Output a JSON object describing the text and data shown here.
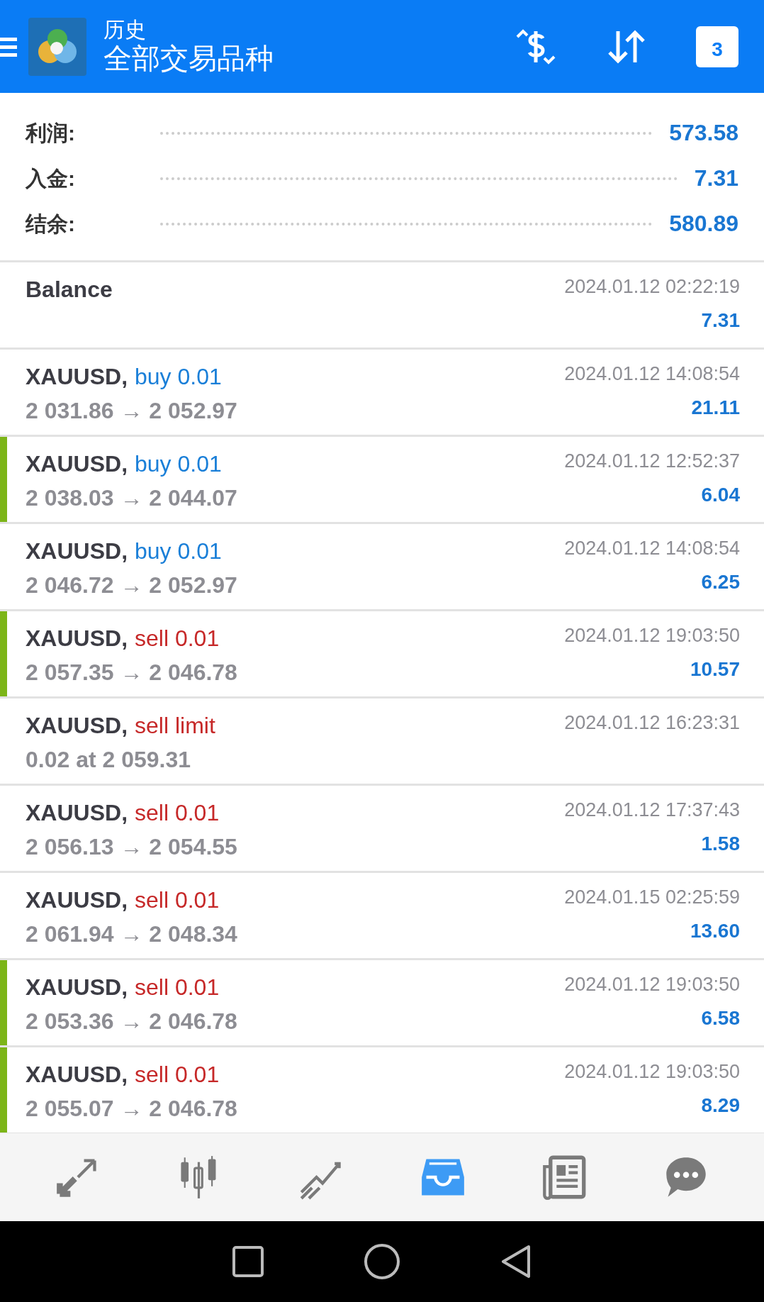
{
  "header": {
    "title": "历史",
    "subtitle": "全部交易品种",
    "calendar_day": "3"
  },
  "summary": [
    {
      "label": "利润:",
      "value": "573.58"
    },
    {
      "label": "入金:",
      "value": "7.31"
    },
    {
      "label": "结余:",
      "value": "580.89"
    }
  ],
  "deals": [
    {
      "kind": "balance",
      "symbol": "Balance",
      "time": "2024.01.12 02:22:19",
      "profit": "7.31",
      "marked": false
    },
    {
      "kind": "trade",
      "symbol": "XAUUSD,",
      "color": "#1a7fd8",
      "action": "buy 0.01",
      "prices": "2 031.86 → 2 052.97",
      "time": "2024.01.12 14:08:54",
      "profit": "21.11",
      "marked": false
    },
    {
      "kind": "trade",
      "symbol": "XAUUSD,",
      "color": "#1a7fd8",
      "action": "buy 0.01",
      "prices": "2 038.03 → 2 044.07",
      "time": "2024.01.12 12:52:37",
      "profit": "6.04",
      "marked": true
    },
    {
      "kind": "trade",
      "symbol": "XAUUSD,",
      "color": "#1a7fd8",
      "action": "buy 0.01",
      "prices": "2 046.72 → 2 052.97",
      "time": "2024.01.12 14:08:54",
      "profit": "6.25",
      "marked": false
    },
    {
      "kind": "trade",
      "symbol": "XAUUSD,",
      "color": "#c62828",
      "action": "sell 0.01",
      "prices": "2 057.35 → 2 046.78",
      "time": "2024.01.12 19:03:50",
      "profit": "10.57",
      "marked": true
    },
    {
      "kind": "order",
      "symbol": "XAUUSD,",
      "color": "#c62828",
      "action": "sell limit",
      "prices": "0.02 at 2 059.31",
      "time": "2024.01.12 16:23:31",
      "marked": false
    },
    {
      "kind": "trade",
      "symbol": "XAUUSD,",
      "color": "#c62828",
      "action": "sell 0.01",
      "prices": "2 056.13 → 2 054.55",
      "time": "2024.01.12 17:37:43",
      "profit": "1.58",
      "marked": false
    },
    {
      "kind": "trade",
      "symbol": "XAUUSD,",
      "color": "#c62828",
      "action": "sell 0.01",
      "prices": "2 061.94 → 2 048.34",
      "time": "2024.01.15 02:25:59",
      "profit": "13.60",
      "marked": false
    },
    {
      "kind": "trade",
      "symbol": "XAUUSD,",
      "color": "#c62828",
      "action": "sell 0.01",
      "prices": "2 053.36 → 2 046.78",
      "time": "2024.01.12 19:03:50",
      "profit": "6.58",
      "marked": true
    },
    {
      "kind": "trade",
      "symbol": "XAUUSD,",
      "color": "#c62828",
      "action": "sell 0.01",
      "prices": "2 055.07 → 2 046.78",
      "time": "2024.01.12 19:03:50",
      "profit": "8.29",
      "marked": true
    }
  ],
  "bottom_nav": [
    {
      "selected": false
    },
    {
      "selected": false
    },
    {
      "selected": false
    },
    {
      "selected": true
    },
    {
      "selected": false
    },
    {
      "selected": false
    }
  ]
}
